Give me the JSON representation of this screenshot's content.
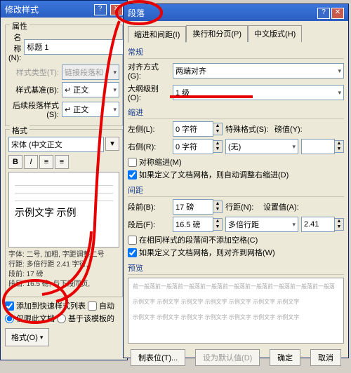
{
  "modstyle": {
    "title": "修改样式",
    "attrs_group": "属性",
    "name_lbl": "名称(N):",
    "name_val": "标题 1",
    "type_lbl": "样式类型(T):",
    "type_val": "链接段落和",
    "base_lbl": "样式基准(B):",
    "base_val": "↵ 正文",
    "next_lbl": "后续段落样式(S):",
    "next_val": "↵ 正文",
    "fmt_group": "格式",
    "font_val": "宋体 (中文正文",
    "preview_text": "示例文字  示例",
    "desc": "字体: 二号, 加粗, 字距调整二号\n行距: 多倍行距 2.41 字行,\n段前: 17 磅\n段后: 16.5 磅, 与下段同页,",
    "add_list": "添加到快速样式列表",
    "autoupd": "自动",
    "only_doc": "仅限此文档",
    "based_tpl": "基于该模板的",
    "fmt_btn": "格式(O)"
  },
  "para": {
    "title": "段落",
    "tabs": [
      "缩进和间距(I)",
      "换行和分页(P)",
      "中文版式(H)"
    ],
    "sect_general": "常规",
    "align_lbl": "对齐方式(G):",
    "align_val": "两端对齐",
    "outline_lbl": "大纲级别(O):",
    "outline_val": "1 级",
    "sect_indent": "缩进",
    "left_lbl": "左侧(L):",
    "left_val": "0 字符",
    "right_lbl": "右侧(R):",
    "right_val": "0 字符",
    "special_lbl": "特殊格式(S):",
    "special_val": "(无)",
    "yval_lbl": "磅值(Y):",
    "mirror": "对称缩进(M)",
    "auto_indent": "如果定义了文档网格，则自动调整右缩进(D)",
    "sect_spacing": "间距",
    "before_lbl": "段前(B):",
    "before_val": "17 磅",
    "after_lbl": "段后(F):",
    "after_val": "16.5 磅",
    "lh_lbl": "行距(N):",
    "lh_val": "多倍行距",
    "setval_lbl": "设置值(A):",
    "setval_val": "2.41",
    "nospace": "在相同样式的段落间不添加空格(C)",
    "snapgrid": "如果定义了文档网格，则对齐到网格(W)",
    "sect_preview": "预览",
    "preview_body": "前一般落前一般落前一般落前一般落前一般落前一般落前一般落前一般落前一般落\n\n示例文字 示例文字 示例文字 示例文字 示例文字 示例文字 示例文字\n\n示例文字 示例文字 示例文字 示例文字 示例文字 示例文字 示例文字",
    "tabstops": "制表位(T)...",
    "default": "设为默认值(D)",
    "ok": "确定",
    "cancel": "取消"
  }
}
